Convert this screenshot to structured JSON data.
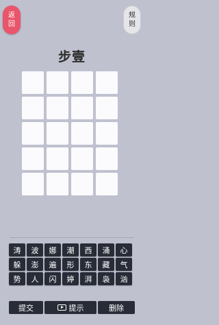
{
  "header": {
    "back_label": [
      "返",
      "回"
    ],
    "rules_label": [
      "规",
      "则"
    ]
  },
  "puzzle": {
    "title": "步壹",
    "grid_rows": 5,
    "grid_cols": 4
  },
  "tiles": [
    [
      "涛",
      "波",
      "娜",
      "潮",
      "西",
      "涌",
      "心"
    ],
    [
      "躲",
      "澎",
      "遍",
      "形",
      "东",
      "藏",
      "气"
    ],
    [
      "势",
      "人",
      "闪",
      "婷",
      "湃",
      "袅",
      "汹"
    ]
  ],
  "actions": {
    "submit": "提交",
    "hint": "提示",
    "delete": "删除"
  },
  "colors": {
    "background": "#bfc1cf",
    "back_button": "#e9556a",
    "tile": "#272c37",
    "cell": "#fbfbfd"
  }
}
